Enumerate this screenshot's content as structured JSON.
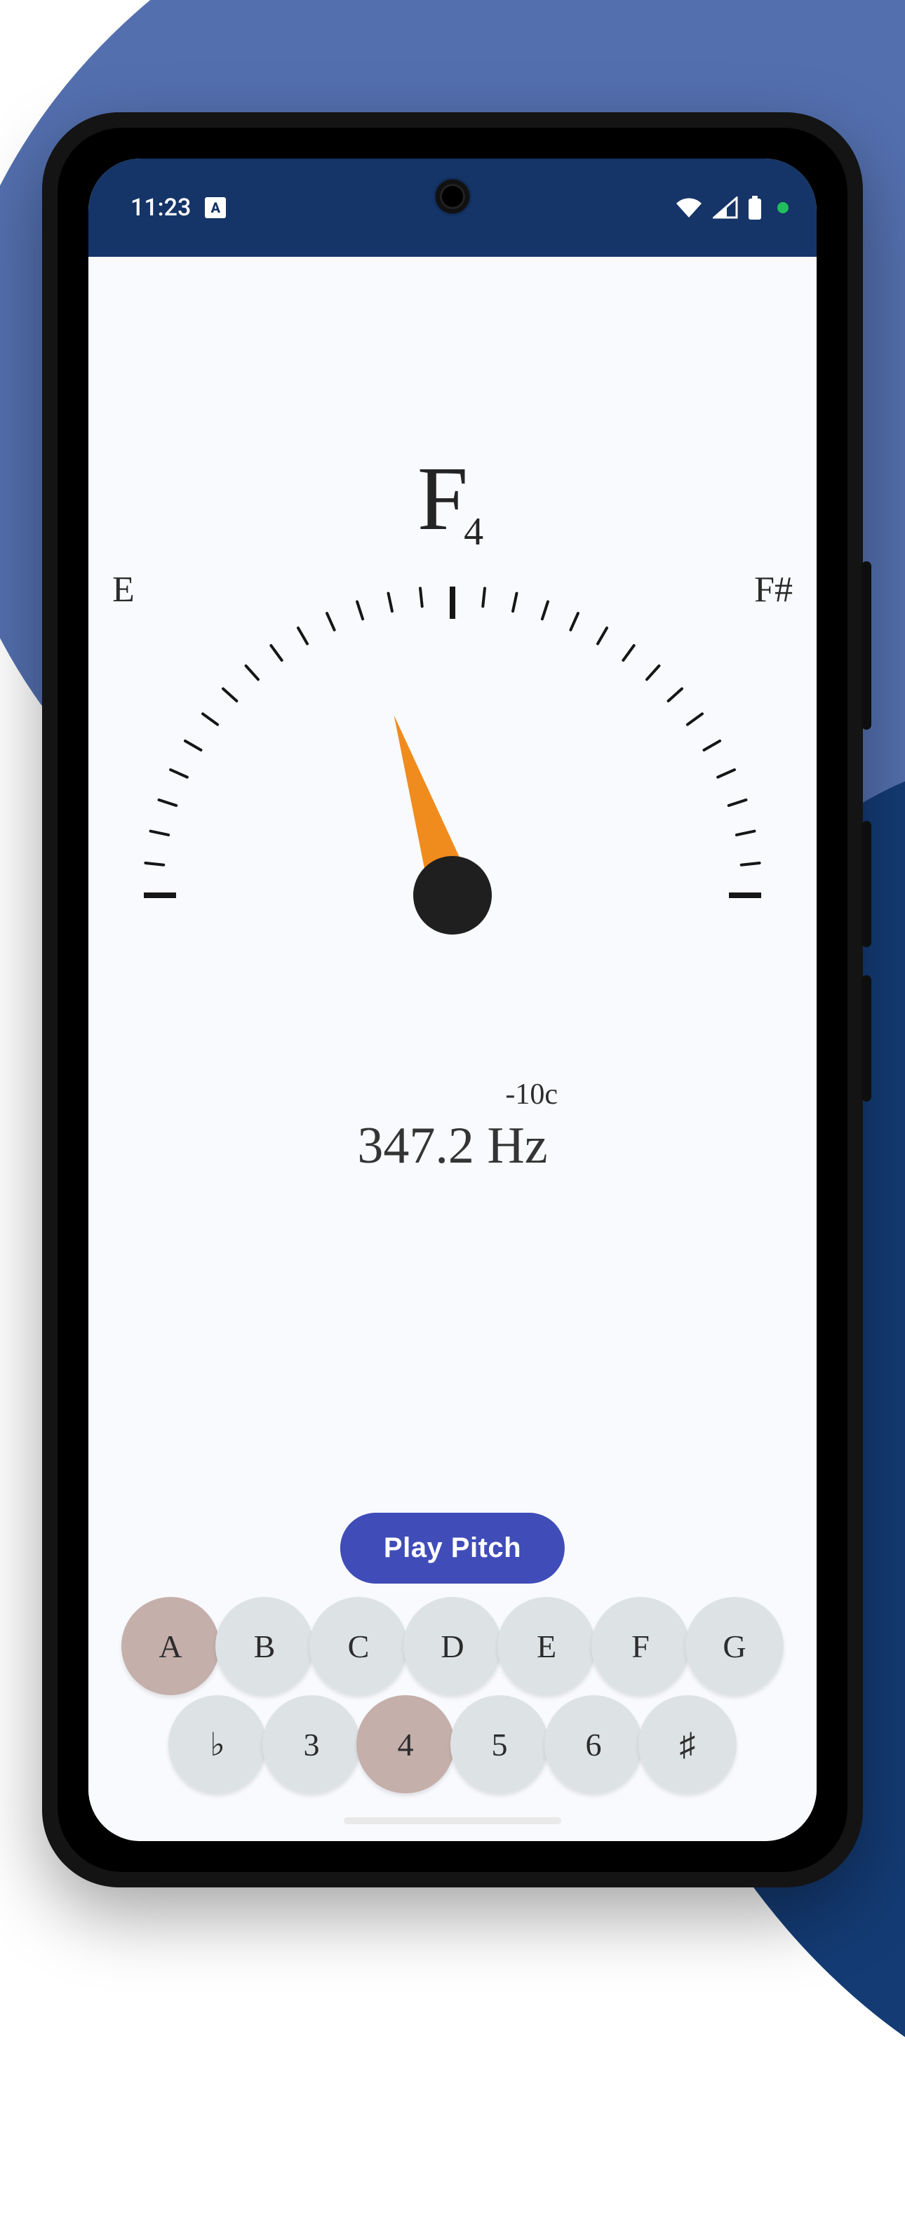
{
  "status": {
    "time": "11:23",
    "lang_indicator": "A"
  },
  "tuner": {
    "note_letter": "F",
    "note_octave": "4",
    "neighbor_left": "E",
    "neighbor_right": "F#",
    "cents_label": "-10c",
    "cents_value": -10,
    "hz_label": "347.2 Hz"
  },
  "controls": {
    "play_label": "Play Pitch",
    "note_row": [
      {
        "label": "A",
        "selected": true
      },
      {
        "label": "B",
        "selected": false
      },
      {
        "label": "C",
        "selected": false
      },
      {
        "label": "D",
        "selected": false
      },
      {
        "label": "E",
        "selected": false
      },
      {
        "label": "F",
        "selected": false
      },
      {
        "label": "G",
        "selected": false
      }
    ],
    "mod_row": [
      {
        "label": "♭",
        "selected": false
      },
      {
        "label": "3",
        "selected": false
      },
      {
        "label": "4",
        "selected": true
      },
      {
        "label": "5",
        "selected": false
      },
      {
        "label": "6",
        "selected": false
      },
      {
        "label": "♯",
        "selected": false
      }
    ]
  },
  "colors": {
    "accent": "#404cb8",
    "needle": "#f08b1d",
    "status_bar": "#153467",
    "bg_blob": "#536fae",
    "bg_blob_dark": "#143b74",
    "chip": "#dde3e5",
    "chip_selected": "#c5afaa"
  }
}
